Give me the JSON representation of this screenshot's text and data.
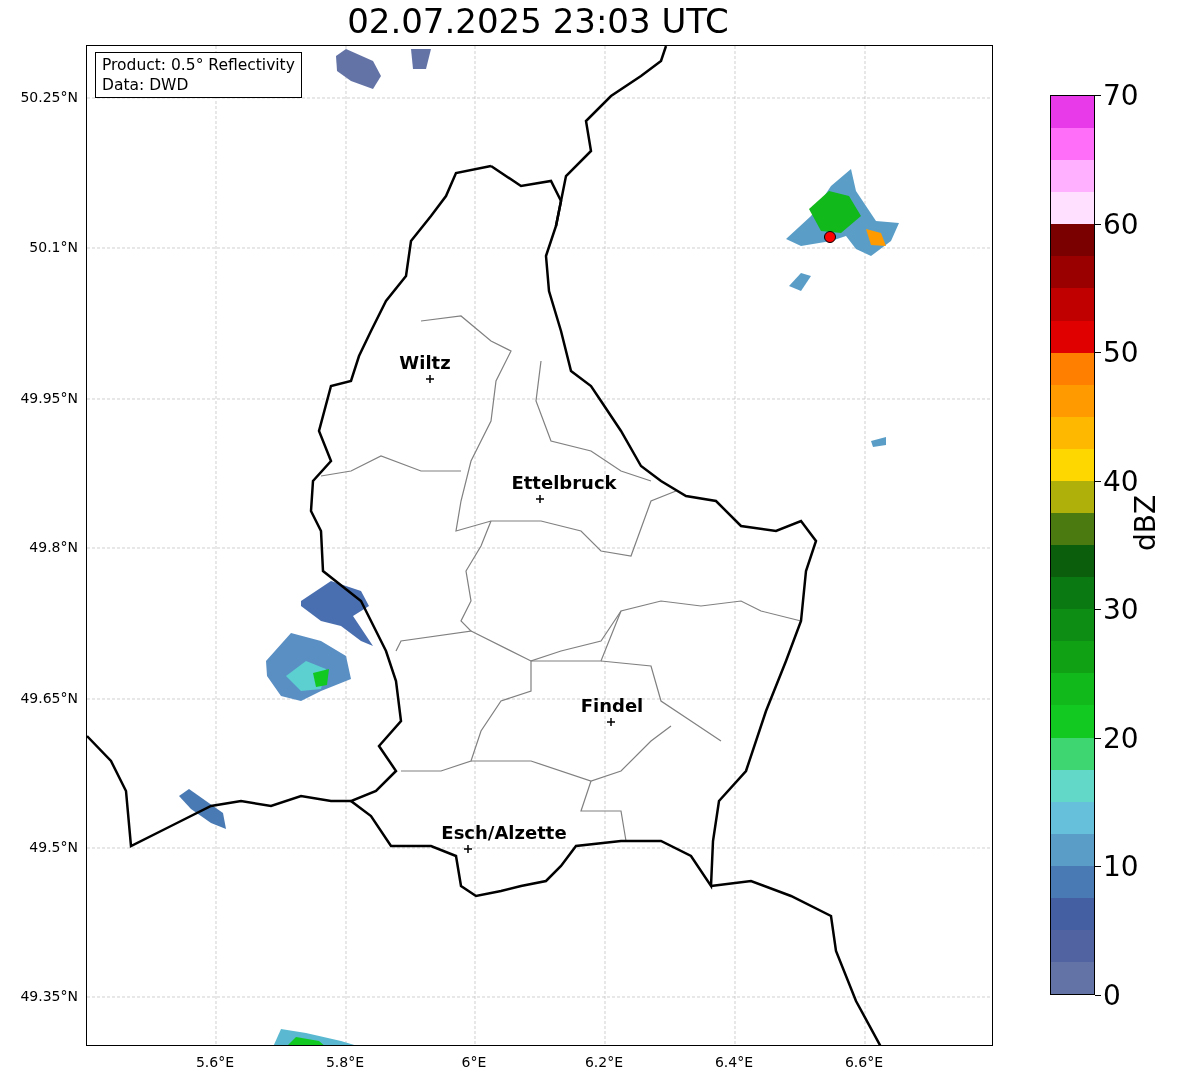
{
  "title": "02.07.2025 23:03 UTC",
  "info_box": {
    "lines": [
      "Product: 0.5° Reflectivity",
      "Data: DWD"
    ]
  },
  "map": {
    "lat_ticks": [
      "50.25°N",
      "50.1°N",
      "49.95°N",
      "49.8°N",
      "49.65°N",
      "49.5°N",
      "49.35°N"
    ],
    "lon_ticks": [
      "5.6°E",
      "5.8°E",
      "6°E",
      "6.2°E",
      "6.4°E",
      "6.6°E"
    ],
    "cities": [
      {
        "name": "Wiltz"
      },
      {
        "name": "Ettelbruck"
      },
      {
        "name": "Findel"
      },
      {
        "name": "Esch/Alzette"
      }
    ]
  },
  "colorbar": {
    "label": "dBZ",
    "ticks": [
      "70",
      "60",
      "50",
      "40",
      "30",
      "20",
      "10",
      "0"
    ],
    "segments": [
      {
        "color": "#e83ae8"
      },
      {
        "color": "#ff6ef8"
      },
      {
        "color": "#ffb0ff"
      },
      {
        "color": "#ffe0ff"
      },
      {
        "color": "#7a0000"
      },
      {
        "color": "#9a0000"
      },
      {
        "color": "#c00000"
      },
      {
        "color": "#e00000"
      },
      {
        "color": "#ff7f00"
      },
      {
        "color": "#ff9a00"
      },
      {
        "color": "#ffb800"
      },
      {
        "color": "#ffd700"
      },
      {
        "color": "#b0b00a"
      },
      {
        "color": "#4a7a10"
      },
      {
        "color": "#0a5e0c"
      },
      {
        "color": "#0b7911"
      },
      {
        "color": "#0e8d14"
      },
      {
        "color": "#10a214"
      },
      {
        "color": "#12b91a"
      },
      {
        "color": "#12c922"
      },
      {
        "color": "#3ed670"
      },
      {
        "color": "#61d8c8"
      },
      {
        "color": "#66c0dc"
      },
      {
        "color": "#5a9ec8"
      },
      {
        "color": "#4a7ab3"
      },
      {
        "color": "#4460a2"
      },
      {
        "color": "#5163a0"
      },
      {
        "color": "#6373a6"
      }
    ]
  }
}
